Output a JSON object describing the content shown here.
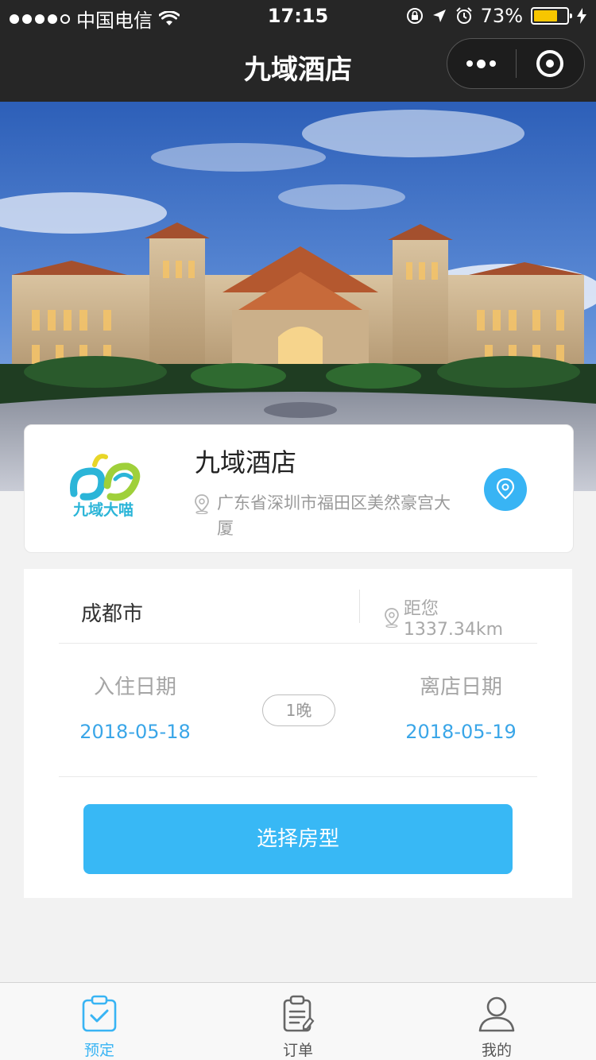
{
  "status_bar": {
    "carrier": "中国电信",
    "time": "17:15",
    "battery_percent": "73%",
    "battery_level": 0.73,
    "colors": {
      "battery": "#f7c600"
    }
  },
  "nav": {
    "title": "九域酒店",
    "more_icon": "more-dots-icon",
    "close_icon": "target-circle-icon"
  },
  "banner": {
    "icon": "hotel-photo"
  },
  "hotel": {
    "logo_text": "九域大喵",
    "name": "九域酒店",
    "address": "广东省深圳市福田区美然豪宫大厦",
    "map_icon": "location-pin-icon"
  },
  "booking": {
    "city": "成都市",
    "distance": "距您1337.34km",
    "checkin_label": "入住日期",
    "checkin_date": "2018-05-18",
    "nights": "1晚",
    "checkout_label": "离店日期",
    "checkout_date": "2018-05-19",
    "select_button": "选择房型"
  },
  "tabs": [
    {
      "label": "预定",
      "icon": "clipboard-check-icon",
      "active": true
    },
    {
      "label": "订单",
      "icon": "order-list-icon",
      "active": false
    },
    {
      "label": "我的",
      "icon": "user-icon",
      "active": false
    }
  ],
  "colors": {
    "accent": "#38b8f5",
    "date_text": "#3aa6e8",
    "nav_bg": "#262626"
  }
}
